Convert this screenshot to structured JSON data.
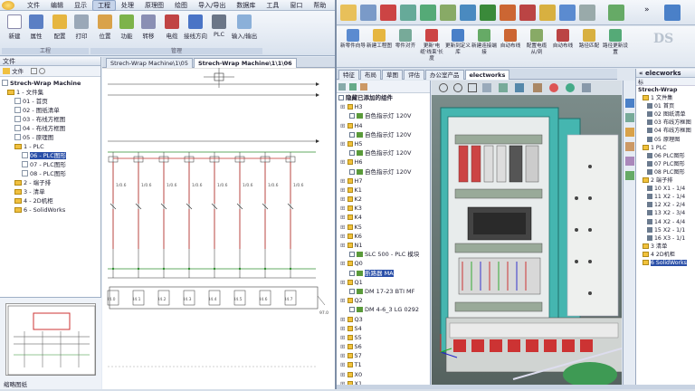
{
  "left": {
    "menu": [
      "文件",
      "编辑",
      "显示",
      "工程",
      "处理",
      "原理图",
      "绘图",
      "导入/导出",
      "数据库",
      "工具",
      "窗口",
      "帮助"
    ],
    "menu_active": "工程",
    "ribbon": {
      "buttons": [
        "新建",
        "属性",
        "配置",
        "打印",
        "位置",
        "功能",
        "转移",
        "电缆",
        "接线方向",
        "PLC",
        "输入/输出"
      ],
      "groups": [
        "工程",
        "管理"
      ]
    },
    "tree_panel": {
      "header": "文件",
      "toolbar_label": "文件",
      "items": [
        "Strech-Wrap Machine",
        "1 - 文件集",
        "01 - 首页",
        "02 - 图纸清单",
        "03 - 布线方框图",
        "04 - 布线方框图",
        "05 - 原理图",
        "1 - PLC",
        "06 - PLC图形",
        "07 - PLC图形",
        "08 - PLC图形",
        "2 - 端子排",
        "3 - 清单",
        "4 - 2D机柜",
        "6 - SolidWorks"
      ],
      "selected_index": 8
    },
    "preview_label": "缩略图纸",
    "doc_tabs": [
      "Strech-Wrap Machine\\1\\05",
      "Strech-Wrap Machine\\1\\1\\06"
    ],
    "schematic_labels": [
      "1/0.6",
      "1/0.6",
      "1/0.6",
      "1/0.6",
      "1/0.6",
      "1/0.6",
      "1/0.6",
      "1/0.6"
    ],
    "plc_labels": [
      "I4.0",
      "I4.1",
      "I4.2",
      "I4.3",
      "I4.4",
      "I4.5",
      "I4.6",
      "I4.7"
    ]
  },
  "right": {
    "ribbon_buttons": [
      "新零件向导",
      "新建工程图",
      "零件对齐",
      "更新'电缆'线束'长度",
      "更新到定义库",
      "新建连接端接",
      "自动布线",
      "配置电缆从/到",
      "自动布线",
      "路径匹配",
      "路径更新设置"
    ],
    "panel_tabs": [
      "特征",
      "布局",
      "草图",
      "评估",
      "办公室产品",
      "electworks"
    ],
    "active_panel_tab": "electworks",
    "comp_header": "隐藏已添加的组件",
    "components": [
      "H3",
      "自色指示灯 120V",
      "H4",
      "自色指示灯 120V",
      "H5",
      "自色指示灯 120V",
      "H6",
      "自色指示灯 120V",
      "H7",
      "K1",
      "K2",
      "K3",
      "K4",
      "K5",
      "K6",
      "N1",
      "SLC 500 - PLC 模块",
      "Q0",
      "断路器 MA",
      "Q1",
      "DM 17-23 BTI MF",
      "Q2",
      "DM 4-6_3 LG 0292",
      "Q3",
      "S4",
      "S5",
      "S6",
      "S7",
      "T1",
      "X0",
      "X1",
      "X2"
    ],
    "components_selected_index": 18,
    "elec_tab": "elecworks",
    "elec_header": "标",
    "elec_col": "Strech-Wra",
    "elec_tree": [
      "Strech-Wrap",
      "1",
      "文件集",
      "01",
      "首页",
      "02",
      "图纸清单",
      "03",
      "布线方框图",
      "04",
      "布线方框图",
      "05",
      "原理图",
      "1",
      "PLC",
      "06",
      "PLC图形",
      "07",
      "PLC图形",
      "08",
      "PLC图形",
      "2",
      "端子排",
      "10",
      "X1 - 1/4",
      "11",
      "X2 - 1/4",
      "12",
      "X2 - 2/4",
      "13",
      "X2 - 3/4",
      "14",
      "X2 - 4/4",
      "15",
      "X2 - 1/1",
      "16",
      "X3 - 1/1",
      "3",
      "清单",
      "4",
      "2D机柜",
      "6",
      "SolidWorks"
    ],
    "bottom_tabs": [
      "模型",
      "运动算例1"
    ]
  },
  "colors": {
    "selection": "#2a4fa8",
    "panel_bg": "#e4ebf4",
    "schematic_red": "#c0302c",
    "schematic_green": "#2f8f2f",
    "viewport_bg": "#5e6e6e",
    "cabinet": "#45b6b0"
  }
}
